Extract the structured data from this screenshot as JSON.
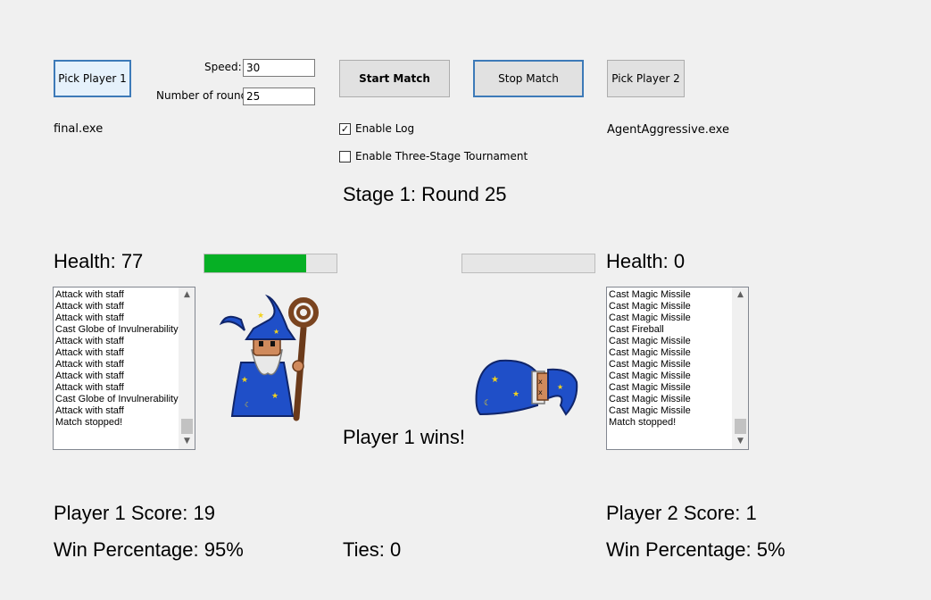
{
  "controls": {
    "pick_player1": "Pick Player 1",
    "pick_player2": "Pick Player 2",
    "speed_label": "Speed:",
    "speed_value": "30",
    "rounds_label": "Number of rounds:",
    "rounds_value": "25",
    "start_match": "Start Match",
    "stop_match": "Stop Match",
    "enable_log": "Enable Log",
    "enable_log_checked": true,
    "enable_tournament": "Enable Three-Stage Tournament",
    "enable_tournament_checked": false
  },
  "player1": {
    "exe": "final.exe",
    "health_text": "Health: 77",
    "health_fraction": 0.77,
    "log": [
      "Attack with staff",
      "Attack with staff",
      "Attack with staff",
      "Cast Globe of Invulnerability",
      "Attack with staff",
      "Attack with staff",
      "Attack with staff",
      "Attack with staff",
      "Attack with staff",
      "Cast Globe of Invulnerability",
      "Attack with staff",
      "Match stopped!"
    ],
    "score": "Player 1 Score: 19",
    "win_pct": "Win Percentage: 95%"
  },
  "player2": {
    "exe": "AgentAggressive.exe",
    "health_text": "Health: 0",
    "health_fraction": 0,
    "log": [
      "Cast Magic Missile",
      "Cast Magic Missile",
      "Cast Magic Missile",
      "Cast Fireball",
      "Cast Magic Missile",
      "Cast Magic Missile",
      "Cast Magic Missile",
      "Cast Magic Missile",
      "Cast Magic Missile",
      "Cast Magic Missile",
      "Cast Magic Missile",
      "Match stopped!"
    ],
    "score": "Player 2 Score: 1",
    "win_pct": "Win Percentage: 5%"
  },
  "stage_text": "Stage 1: Round 25",
  "result_text": "Player 1 wins!",
  "ties_text": "Ties: 0",
  "colors": {
    "health_fill": "#06b025",
    "wizard_robe": "#1f4fc8"
  }
}
